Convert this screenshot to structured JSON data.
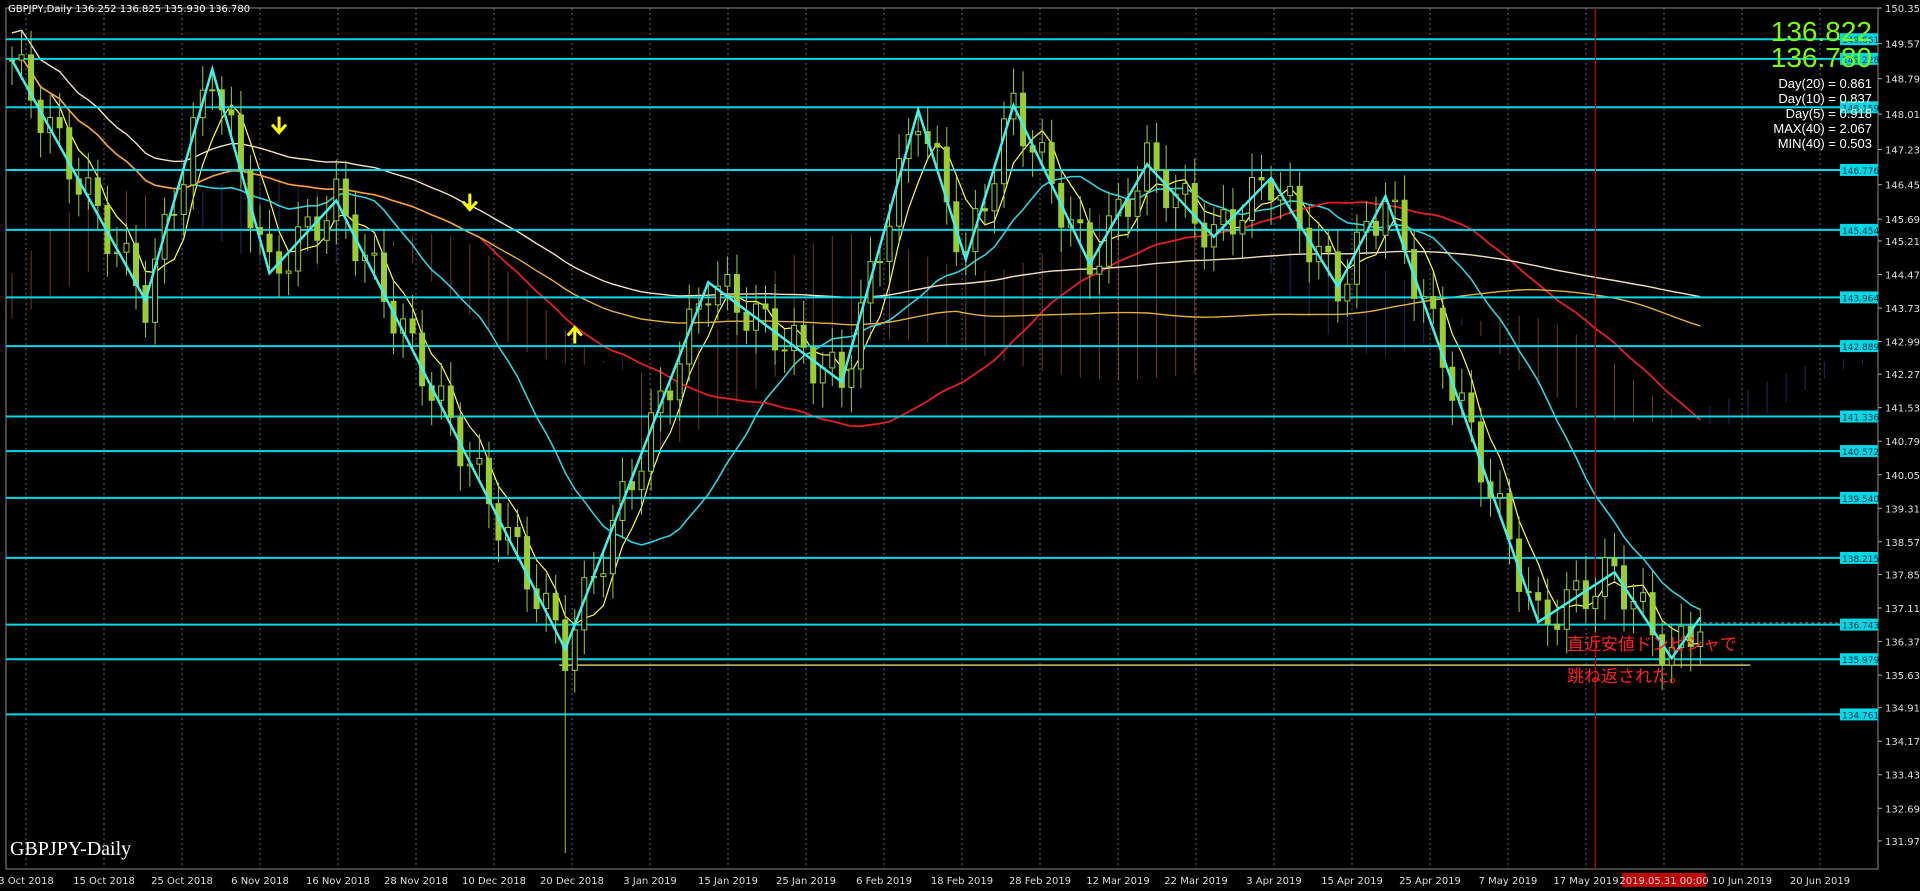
{
  "header": {
    "symbol": "GBPJPY,Daily",
    "ohlc": "136.252 136.825 135.930 136.780"
  },
  "prices": {
    "bid": "136.822",
    "ask": "136.780"
  },
  "stats": [
    "Day(20) = 0.861",
    "Day(10) = 0.837",
    "Day(5) = 0.918",
    "MAX(40) = 2.067",
    "MIN(40) = 0.503"
  ],
  "watermark": "GBPJPY-Daily",
  "annotation": {
    "line1": "直近安値ドンピシャで",
    "line2": "跳ね返された。"
  },
  "colors": {
    "background": "#000000",
    "level_line": "#00d8e8",
    "candle": "#9acd32",
    "support_line": "#c8c864",
    "red_vline": "#c00000",
    "annotation": "#ff2020",
    "price_text": "#7cfc00"
  },
  "chart_data": {
    "type": "candlestick",
    "symbol": "GBPJPY",
    "timeframe": "Daily",
    "ylim": [
      131.35,
      150.35
    ],
    "y_ticks": [
      "150.350",
      "149.570",
      "148.790",
      "148.010",
      "147.230",
      "146.450",
      "145.690",
      "145.210",
      "144.470",
      "143.730",
      "142.990",
      "142.270",
      "141.530",
      "140.790",
      "140.050",
      "139.310",
      "138.570",
      "137.850",
      "137.110",
      "136.370",
      "135.630",
      "134.910",
      "134.170",
      "133.430",
      "132.690",
      "131.970"
    ],
    "x_ticks": [
      "3 Oct 2018",
      "15 Oct 2018",
      "25 Oct 2018",
      "6 Nov 2018",
      "16 Nov 2018",
      "28 Nov 2018",
      "10 Dec 2018",
      "20 Dec 2018",
      "3 Jan 2019",
      "15 Jan 2019",
      "25 Jan 2019",
      "6 Feb 2019",
      "18 Feb 2019",
      "28 Feb 2019",
      "12 Mar 2019",
      "22 Mar 2019",
      "3 Apr 2019",
      "15 Apr 2019",
      "25 Apr 2019",
      "7 May 2019",
      "17 May 2019",
      "2019.05.31 00:00",
      "10 Jun 2019",
      "20 Jun 2019"
    ],
    "levels": [
      {
        "value": 149.661,
        "label": "149.661"
      },
      {
        "value": 149.228,
        "label": "149.228"
      },
      {
        "value": 148.159,
        "label": "148.159"
      },
      {
        "value": 146.776,
        "label": "146.776"
      },
      {
        "value": 145.454,
        "label": "145.454"
      },
      {
        "value": 143.964,
        "label": "143.964"
      },
      {
        "value": 142.889,
        "label": "142.889"
      },
      {
        "value": 141.336,
        "label": "141.336"
      },
      {
        "value": 140.572,
        "label": "140.572"
      },
      {
        "value": 139.54,
        "label": "139.540"
      },
      {
        "value": 138.215,
        "label": "138.215"
      },
      {
        "value": 136.743,
        "label": "136.743"
      },
      {
        "value": 135.979,
        "label": "135.979"
      },
      {
        "value": 134.761,
        "label": "134.761"
      }
    ],
    "support": 135.85,
    "current_price": 136.78,
    "zigzag": [
      [
        0,
        149.2
      ],
      [
        14,
        143.9
      ],
      [
        21,
        149.0
      ],
      [
        27,
        144.5
      ],
      [
        34,
        146.1
      ],
      [
        58,
        136.2
      ],
      [
        73,
        144.3
      ],
      [
        87,
        142.1
      ],
      [
        95,
        148.1
      ],
      [
        100,
        144.8
      ],
      [
        105,
        148.2
      ],
      [
        113,
        144.7
      ],
      [
        119,
        146.9
      ],
      [
        126,
        145.3
      ],
      [
        132,
        146.6
      ],
      [
        139,
        144.2
      ],
      [
        144,
        146.2
      ],
      [
        160,
        136.8
      ],
      [
        168,
        137.9
      ],
      [
        174,
        136.0
      ],
      [
        177,
        136.9
      ]
    ]
  }
}
